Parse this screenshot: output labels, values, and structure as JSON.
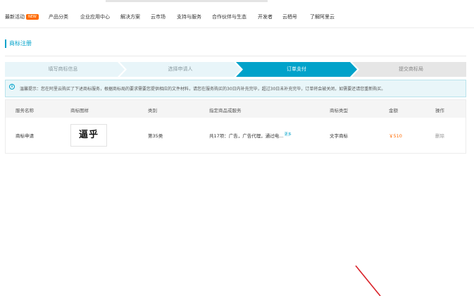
{
  "topnav": {
    "items": [
      {
        "label": "最新活动",
        "badge": "NEW"
      },
      {
        "label": "产品分类"
      },
      {
        "label": "企业应用中心"
      },
      {
        "label": "解决方案"
      },
      {
        "label": "云市场"
      },
      {
        "label": "支持与服务"
      },
      {
        "label": "合作伙伴与生态"
      },
      {
        "label": "开发者"
      },
      {
        "label": "云栖号"
      },
      {
        "label": "了解阿里云"
      }
    ]
  },
  "page": {
    "title": "商标注册"
  },
  "steps": {
    "items": [
      "填写商标信息",
      "选择申请人",
      "订单支付",
      "提交商标局"
    ],
    "active_index": 2,
    "colors": {
      "done": "#e8f5f9",
      "active": "#00a2ca",
      "pending": "#e6e6e6"
    }
  },
  "notice": {
    "icon": "info-icon",
    "text": "温馨提示：您在阿里云购买了下述商标服务，根据商标局的要求需要您提供相应的文件材料，请您在服务购买的30日内补充完毕，超过30日未补充完毕，订单将会被关闭，如需要还请您重新购买。"
  },
  "table": {
    "headers": [
      "服务名称",
      "商标图样",
      "类别",
      "指定商品或服务",
      "商标类型",
      "金额",
      "操作"
    ],
    "row": {
      "service": "商标申请",
      "trademark": "逼乎",
      "category": "第35类",
      "goods": "共17项：广告，广告代理，通过电…",
      "more": "更多",
      "type": "文字商标",
      "amount": "￥510",
      "action": "删除"
    }
  },
  "colors": {
    "accent": "#00a2ca",
    "brand_orange": "#ff6a00",
    "annotation_red": "#d9232a"
  }
}
